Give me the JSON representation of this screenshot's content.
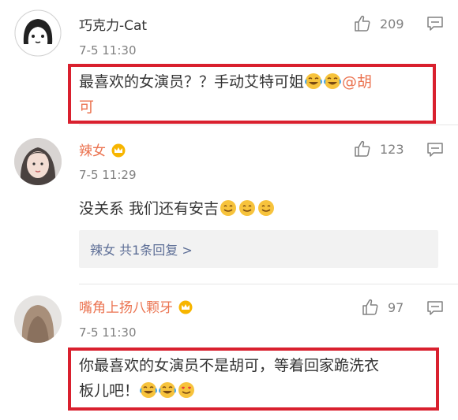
{
  "comments": [
    {
      "username": "巧克力-Cat",
      "time": "7-5 11:30",
      "likes": "209",
      "text": "最喜欢的女演员？？手动艾特可姐",
      "mention_part1": "@胡",
      "mention_part2": "可"
    },
    {
      "username": "辣女",
      "time": "7-5 11:29",
      "likes": "123",
      "text": "没关系 我们还有安吉",
      "reply_summary": "辣女 共1条回复 >"
    },
    {
      "username": "嘴角上扬八颗牙",
      "time": "7-5 11:30",
      "likes": "97",
      "text_line1": "你最喜欢的女演员不是胡可，等着回家跪洗衣",
      "text_line2": "板儿吧！"
    }
  ],
  "icons": {
    "like": "thumbs-up-icon",
    "reply": "comment-bubble-icon",
    "vip": "crown-badge-icon",
    "laugh": "laughing-tears-emoji",
    "smile": "smile-emoji",
    "love": "hearts-eyes-emoji"
  },
  "colors": {
    "highlight": "#d9202e",
    "vip_name": "#eb7350",
    "reply_link": "#5d6e96",
    "meta_gray": "#808080"
  }
}
